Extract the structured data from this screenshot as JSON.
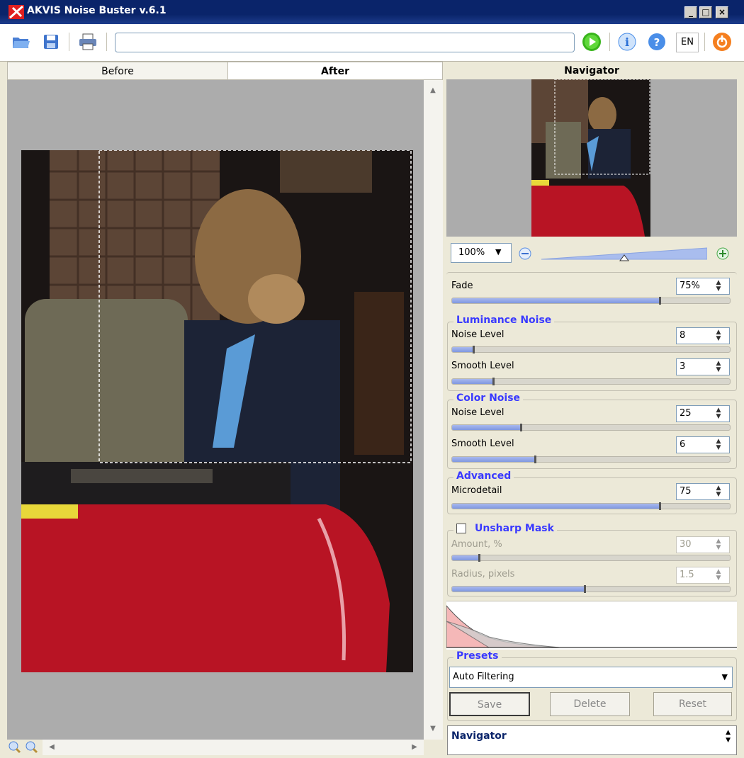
{
  "window": {
    "title": "AKVIS Noise Buster v.6.1"
  },
  "toolbar": {
    "language": "EN"
  },
  "tabs": {
    "before": "Before",
    "after": "After"
  },
  "navigator": {
    "title": "Navigator",
    "zoom": "100%",
    "zoom_level": 0.5
  },
  "fade": {
    "label": "Fade",
    "value": "75%",
    "level": 0.75
  },
  "luminance": {
    "title": "Luminance Noise",
    "noise_label": "Noise Level",
    "noise_value": "8",
    "noise_level": 0.08,
    "smooth_label": "Smooth Level",
    "smooth_value": "3",
    "smooth_level": 0.15
  },
  "color": {
    "title": "Color Noise",
    "noise_label": "Noise Level",
    "noise_value": "25",
    "noise_level": 0.25,
    "smooth_label": "Smooth Level",
    "smooth_value": "6",
    "smooth_level": 0.3
  },
  "advanced": {
    "title": "Advanced",
    "micro_label": "Microdetail",
    "micro_value": "75",
    "micro_level": 0.75
  },
  "unsharp": {
    "title": "Unsharp Mask",
    "amount_label": "Amount, %",
    "amount_value": "30",
    "amount_level": 0.1,
    "radius_label": "Radius, pixels",
    "radius_value": "1.5",
    "radius_level": 0.48
  },
  "presets": {
    "title": "Presets",
    "selected": "Auto Filtering",
    "save": "Save",
    "delete": "Delete",
    "reset": "Reset"
  },
  "bottom_panel": {
    "label": "Navigator"
  },
  "colors": {
    "accent": "#3a3aff",
    "titlebar": "#0a246a",
    "slider": "#8fa4e6"
  }
}
